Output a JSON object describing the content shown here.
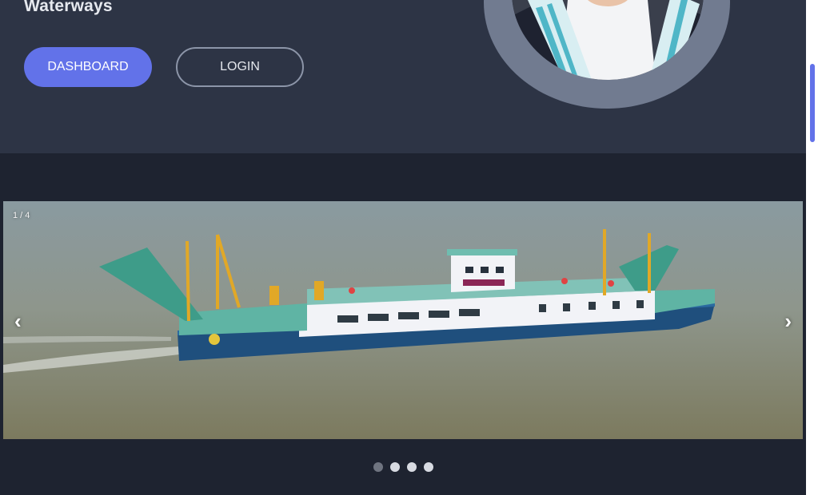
{
  "hero": {
    "title": "Waterways",
    "dashboard_label": "DASHBOARD",
    "login_label": "LOGIN"
  },
  "slider": {
    "counter": "1 / 4",
    "prev_glyph": "‹",
    "next_glyph": "›",
    "total_slides": 4,
    "active_slide": 1
  },
  "colors": {
    "accent": "#6272e9",
    "header_bg": "#2d3445",
    "page_bg": "#1e2330"
  }
}
